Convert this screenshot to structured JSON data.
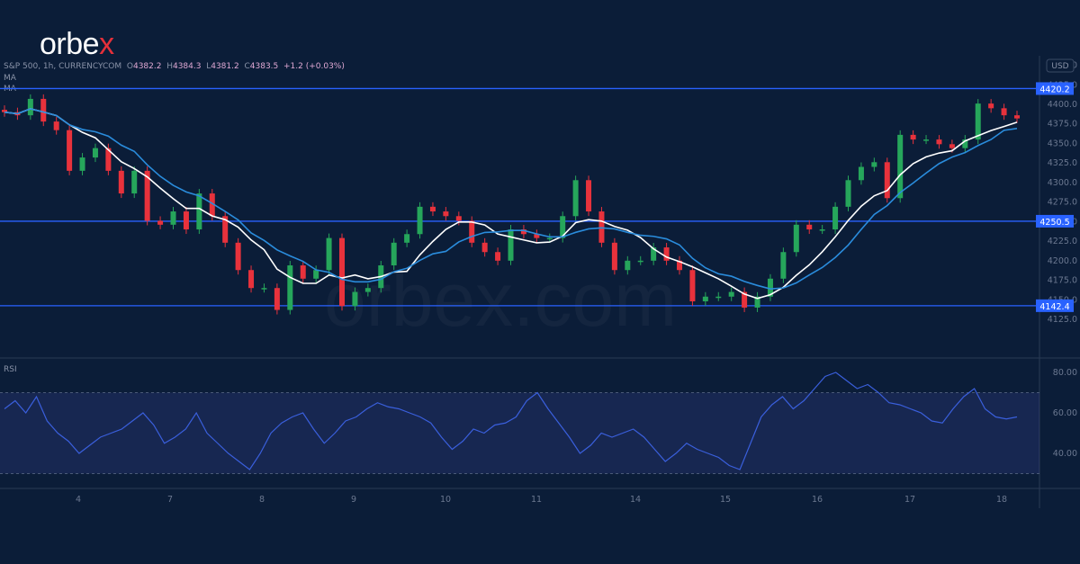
{
  "logo": {
    "text_main": "orbe",
    "text_accent": "x"
  },
  "watermark": "orbex.com",
  "header": {
    "symbol": "S&P 500, 1h, CURRENCYCOM",
    "open_label": "O",
    "open": "4382.2",
    "high_label": "H",
    "high": "4384.3",
    "low_label": "L",
    "low": "4381.2",
    "close_label": "C",
    "close": "4383.5",
    "change": "+1.2 (+0.03%)",
    "ma1": "MA",
    "ma2": "MA"
  },
  "currency": "USD",
  "colors": {
    "up": "#26a65b",
    "down": "#e8323c",
    "level_line": "#2962ff",
    "ma_fast": "#ffffff",
    "ma_slow": "#2a8cdc",
    "rsi": "#3a5fdc"
  },
  "chart_data": [
    {
      "type": "candlestick",
      "title": "S&P 500, 1h, CURRENCYCOM",
      "y_ticks": [
        "4450.0",
        "4425.0",
        "4400.0",
        "4375.0",
        "4350.0",
        "4325.0",
        "4300.0",
        "4275.0",
        "4250.0",
        "4225.0",
        "4200.0",
        "4175.0",
        "4150.0",
        "4125.0"
      ],
      "ylim": [
        4117,
        4460
      ],
      "x_tick_labels": [
        "4",
        "7",
        "8",
        "9",
        "10",
        "11",
        "14",
        "15",
        "16",
        "17",
        "18"
      ],
      "closes": [
        4390,
        4386,
        4407,
        4378,
        4367,
        4315,
        4332,
        4344,
        4315,
        4286,
        4315,
        4251,
        4246,
        4263,
        4240,
        4286,
        4257,
        4223,
        4188,
        4165,
        4165,
        4137,
        4194,
        4177,
        4188,
        4229,
        4142,
        4160,
        4165,
        4194,
        4223,
        4234,
        4269,
        4263,
        4257,
        4251,
        4223,
        4211,
        4200,
        4240,
        4234,
        4229,
        4229,
        4257,
        4303,
        4263,
        4223,
        4188,
        4200,
        4200,
        4217,
        4200,
        4188,
        4148,
        4154,
        4154,
        4160,
        4140,
        4154,
        4177,
        4211,
        4246,
        4240,
        4240,
        4269,
        4303,
        4320,
        4326,
        4280,
        4361,
        4355,
        4355,
        4349,
        4344,
        4355,
        4401,
        4395,
        4386,
        4382
      ],
      "levels": [
        {
          "value": 4420.2,
          "label": "4420.2"
        },
        {
          "value": 4250.5,
          "label": "4250.5"
        },
        {
          "value": 4142.4,
          "label": "4142.4"
        }
      ],
      "indicators": [
        "MA",
        "MA"
      ]
    },
    {
      "type": "line",
      "title": "RSI",
      "y_ticks": [
        "80.00",
        "60.00",
        "40.00"
      ],
      "ylim": [
        22,
        87
      ],
      "bands": [
        30,
        70
      ],
      "values": [
        62,
        66,
        60,
        68,
        56,
        50,
        46,
        40,
        44,
        48,
        50,
        52,
        56,
        60,
        54,
        45,
        48,
        52,
        60,
        50,
        45,
        40,
        36,
        32,
        40,
        50,
        55,
        58,
        60,
        52,
        45,
        50,
        56,
        58,
        62,
        65,
        63,
        62,
        60,
        58,
        55,
        48,
        42,
        46,
        52,
        50,
        54,
        55,
        58,
        66,
        70,
        62,
        55,
        48,
        40,
        44,
        50,
        48,
        50,
        52,
        48,
        42,
        36,
        40,
        45,
        42,
        40,
        38,
        34,
        32,
        45,
        58,
        64,
        68,
        62,
        66,
        72,
        78,
        80,
        76,
        72,
        74,
        70,
        65,
        64,
        62,
        60,
        56,
        55,
        62,
        68,
        72,
        62,
        58,
        57,
        58
      ]
    }
  ]
}
